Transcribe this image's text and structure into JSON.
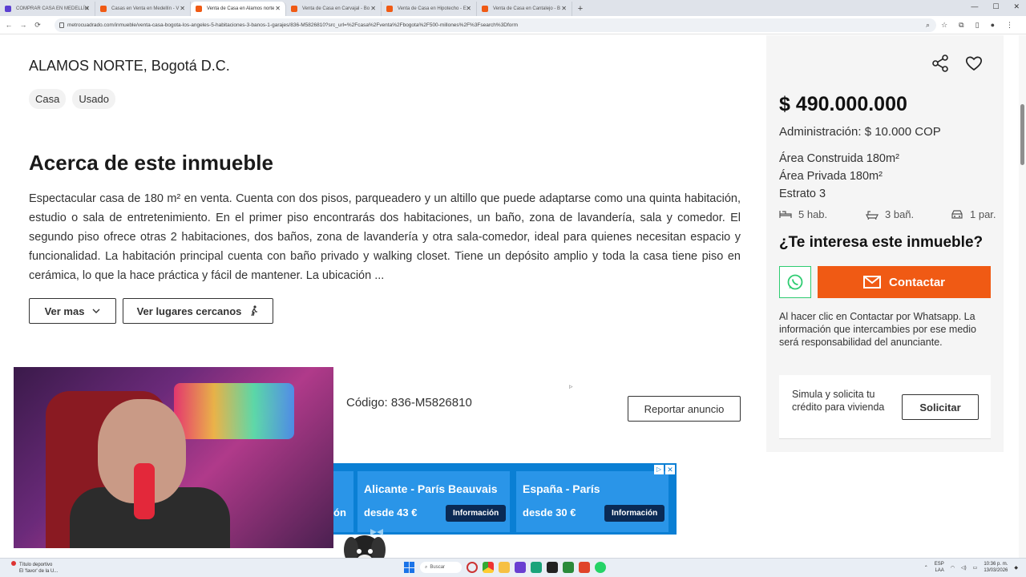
{
  "browser": {
    "tabs": [
      {
        "label": "COMPRAR CASA EN MEDELLÍN",
        "color": "#5b3fd1",
        "active": false
      },
      {
        "label": "Casas en Venta en Medellín - V",
        "color": "#f05a14",
        "active": false
      },
      {
        "label": "Venta de Casa en Alamos norte",
        "color": "#f05a14",
        "active": true
      },
      {
        "label": "Venta de Casa en Carvajal - Bo",
        "color": "#f05a14",
        "active": false
      },
      {
        "label": "Venta de Casa en Hipotecho - E",
        "color": "#f05a14",
        "active": false
      },
      {
        "label": "Venta de Casa en Cantalejo - B",
        "color": "#f05a14",
        "active": false
      }
    ],
    "url": "metrocuadrado.com/inmueble/venta-casa-bogota-los-angeles-5-habitaciones-3-banos-1-garajes/836-M5826810?src_url=%2Fcasa%2Fventa%2Fbogota%2F500-millones%2F%3Fsearch%3Dform"
  },
  "listing": {
    "location": "ALAMOS NORTE, Bogotá D.C.",
    "tags": [
      "Casa",
      "Usado"
    ],
    "about_title": "Acerca de este inmueble",
    "description": "Espectacular casa de 180 m² en venta. Cuenta con dos pisos, parqueadero y un altillo que puede adaptarse como una quinta habitación, estudio o sala de entretenimiento. En el primer piso encontrarás dos habitaciones, un baño, zona de lavandería, sala y comedor. El segundo piso ofrece otras 2 habitaciones, dos baños, zona de lavandería y otra sala-comedor, ideal para quienes necesitan espacio y funcionalidad. La habitación principal cuenta con baño privado y walking closet. Tiene un depósito amplio y toda la casa tiene piso en cerámica, lo que la hace práctica y fácil de mantener. La ubicación ...",
    "ver_mas": "Ver mas",
    "ver_lugares": "Ver lugares cercanos",
    "codigo": "Código: 836-M5826810",
    "reportar": "Reportar anuncio"
  },
  "sidebar": {
    "price": "$ 490.000.000",
    "admin": "Administración: $ 10.000 COP",
    "area_construida": "Área Construida 180m²",
    "area_privada": "Área Privada 180m²",
    "estrato": "Estrato 3",
    "habitaciones": "5 hab.",
    "banos": "3 bañ.",
    "parqueaderos": "1 par.",
    "interest_title": "¿Te interesa este inmueble?",
    "contactar": "Contactar",
    "disclaimer": "Al hacer clic en Contactar por Whatsapp. La información que intercambies por ese medio será responsabilidad del anunciante.",
    "credit_text": "Simula y solicita tu crédito para vivienda",
    "solicitar": "Solicitar",
    "accent": "#f05a14",
    "whatsapp_color": "#2ecc71"
  },
  "ad": {
    "cards": [
      {
        "title": "",
        "price": "ón",
        "button": ""
      },
      {
        "title": "Alicante - París Beauvais",
        "price": "desde 43 €",
        "button": "Información"
      },
      {
        "title": "España - París",
        "price": "desde 30 €",
        "button": "Información"
      }
    ]
  },
  "taskbar": {
    "news_title": "Título deportivo",
    "news_sub": "El 'favor' de la U...",
    "search": "Buscar",
    "lang": "ESP",
    "lang2": "LAA",
    "time": "10:36 p. m.",
    "date": "13/03/2026"
  }
}
